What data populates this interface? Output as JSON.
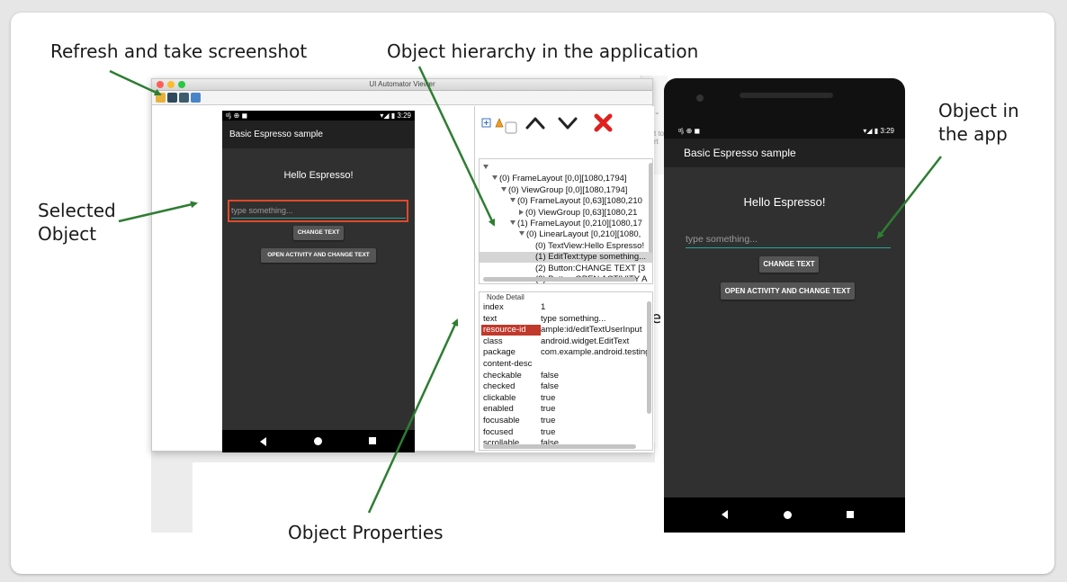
{
  "annotations": {
    "refresh": "Refresh and take screenshot",
    "hierarchy": "Object hierarchy in the application",
    "selected_line1": "Selected",
    "selected_line2": "Object",
    "object_app_line1": "Object in",
    "object_app_line2": "the app",
    "properties": "Object Properties"
  },
  "colors": {
    "arrow": "#2e7d32",
    "selection": "#e04a2a",
    "highlight": "#c0392b",
    "app_bar": "#212121",
    "screen": "#303030",
    "edit_underline": "#26a69a"
  },
  "window": {
    "title": "UI Automator Viewer",
    "toolbar_icons": [
      "folder-icon",
      "device-screenshot-icon",
      "device-screenshot-compressed-icon",
      "save-icon"
    ]
  },
  "device_screenshot": {
    "status_left": "ᵍ|ᵢ ⊕ ◼",
    "status_right": "▾◢ ▮ 3:29",
    "app_title": "Basic Espresso sample",
    "hello": "Hello Espresso!",
    "edit_placeholder": "type something...",
    "btn_change": "CHANGE TEXT",
    "btn_open": "OPEN ACTIVITY AND CHANGE TEXT"
  },
  "tree_toolbar": {
    "icons": [
      "expand-all-icon",
      "warning-icon",
      "toggle-checkbox",
      "up-chevron-icon",
      "down-chevron-icon",
      "delete-x-icon"
    ]
  },
  "tree": [
    {
      "label": "",
      "level": 0,
      "arrow": "down"
    },
    {
      "label": "(0) FrameLayout [0,0][1080,1794]",
      "level": 1,
      "arrow": "down"
    },
    {
      "label": "(0) ViewGroup [0,0][1080,1794]",
      "level": 2,
      "arrow": "down"
    },
    {
      "label": "(0) FrameLayout [0,63][1080,210",
      "level": 3,
      "arrow": "down"
    },
    {
      "label": "(0) ViewGroup [0,63][1080,21",
      "level": 4,
      "arrow": "right"
    },
    {
      "label": "(1) FrameLayout [0,210][1080,17",
      "level": 3,
      "arrow": "down"
    },
    {
      "label": "(0) LinearLayout [0,210][1080,",
      "level": 4,
      "arrow": "down"
    },
    {
      "label": "(0) TextView:Hello Espresso!",
      "level": 5,
      "arrow": "none"
    },
    {
      "label": "(1) EditText:type something...",
      "level": 5,
      "arrow": "none",
      "selected": true
    },
    {
      "label": "(2) Button:CHANGE TEXT [3",
      "level": 5,
      "arrow": "none"
    },
    {
      "label": "(3) Button:OPEN ACTIVITY A",
      "level": 5,
      "arrow": "none"
    }
  ],
  "node_detail": {
    "title": "Node Detail",
    "rows": [
      {
        "key": "index",
        "value": "1"
      },
      {
        "key": "text",
        "value": "type something..."
      },
      {
        "key": "resource-id",
        "value": "ample:id/editTextUserInput",
        "highlight": true
      },
      {
        "key": "class",
        "value": "android.widget.EditText"
      },
      {
        "key": "package",
        "value": "com.example.android.testing"
      },
      {
        "key": "content-desc",
        "value": ""
      },
      {
        "key": "checkable",
        "value": "false"
      },
      {
        "key": "checked",
        "value": "false"
      },
      {
        "key": "clickable",
        "value": "true"
      },
      {
        "key": "enabled",
        "value": "true"
      },
      {
        "key": "focusable",
        "value": "true"
      },
      {
        "key": "focused",
        "value": "true"
      },
      {
        "key": "scrollable",
        "value": "false"
      }
    ]
  },
  "phone": {
    "status_left": "ᵍ|ᵢ ⊕ ◼",
    "status_right": "▾◢ ▮ 3:29",
    "app_title": "Basic Espresso sample",
    "hello": "Hello Espresso!",
    "edit_placeholder": "type something...",
    "btn_change": "CHANGE TEXT",
    "btn_open": "OPEN ACTIVITY AND CHANGE TEXT"
  },
  "background_fragments": {
    "side_text_1": "t to",
    "side_text_2": "rt",
    "chevron": "⌄",
    "letter_e": "e"
  }
}
